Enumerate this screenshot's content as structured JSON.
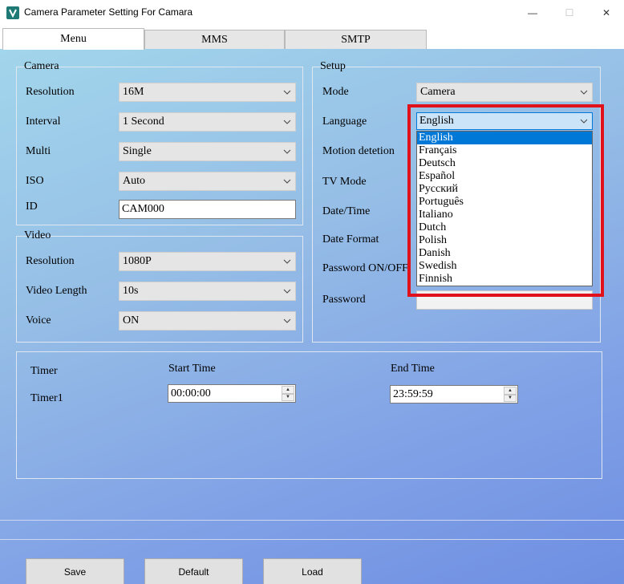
{
  "window": {
    "title": "Camera Parameter Setting For  Camara",
    "minimize": "—",
    "maximize": "☐",
    "close": "✕"
  },
  "tabs": [
    {
      "label": "Menu",
      "active": true
    },
    {
      "label": "MMS",
      "active": false
    },
    {
      "label": "SMTP",
      "active": false
    }
  ],
  "camera": {
    "legend": "Camera",
    "resolution_label": "Resolution",
    "resolution_value": "16M",
    "interval_label": "Interval",
    "interval_value": "1 Second",
    "multi_label": "Multi",
    "multi_value": "Single",
    "iso_label": "ISO",
    "iso_value": "Auto",
    "id_label": "ID",
    "id_value": "CAM000"
  },
  "video": {
    "legend": "Video",
    "resolution_label": "Resolution",
    "resolution_value": "1080P",
    "length_label": "Video Length",
    "length_value": "10s",
    "voice_label": "Voice",
    "voice_value": "ON"
  },
  "setup": {
    "legend": "Setup",
    "mode_label": "Mode",
    "mode_value": "Camera",
    "language_label": "Language",
    "language_value": "English",
    "motion_label": "Motion detetion",
    "tvmode_label": "TV Mode",
    "datetime_label": "Date/Time",
    "dateformat_label": "Date Format",
    "password_onoff_label": "Password ON/OFF",
    "password_label": "Password"
  },
  "language_options": [
    "English",
    "Français",
    "Deutsch",
    "Español",
    "Русский",
    "Português",
    "Italiano",
    "Dutch",
    "Polish",
    "Danish",
    "Swedish",
    "Finnish"
  ],
  "timer": {
    "timer_label": "Timer",
    "timer1_label": "Timer1",
    "start_label": "Start Time",
    "start_value": "00:00:00",
    "end_label": "End Time",
    "end_value": "23:59:59"
  },
  "buttons": {
    "save": "Save",
    "default": "Default",
    "load": "Load"
  },
  "colors": {
    "highlight": "#e0111b",
    "selected_item": "#0078d7"
  }
}
